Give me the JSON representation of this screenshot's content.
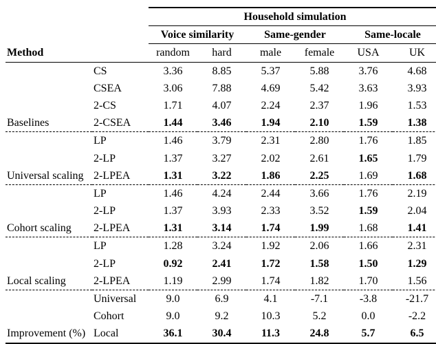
{
  "header": {
    "super": "Household simulation",
    "groups": {
      "g0": "Voice similarity",
      "g1": "Same-gender",
      "g2": "Same-locale"
    },
    "method": "Method",
    "cols": {
      "c0": "random",
      "c1": "hard",
      "c2": "male",
      "c3": "female",
      "c4": "USA",
      "c5": "UK"
    }
  },
  "sections": {
    "baselines": "Baselines",
    "universal": "Universal scaling",
    "cohort": "Cohort scaling",
    "local": "Local scaling",
    "improve": "Improvement (%)"
  },
  "methods": {
    "cs": "CS",
    "csea": "CSEA",
    "twocs": "2-CS",
    "twocsea": "2-CSEA",
    "lp": "LP",
    "twolp": "2-LP",
    "twolpea": "2-LPEA",
    "imp_u": "Universal",
    "imp_c": "Cohort",
    "imp_l": "Local"
  },
  "v": {
    "b_cs": {
      "c0": "3.36",
      "c1": "8.85",
      "c2": "5.37",
      "c3": "5.88",
      "c4": "3.76",
      "c5": "4.68"
    },
    "b_csea": {
      "c0": "3.06",
      "c1": "7.88",
      "c2": "4.69",
      "c3": "5.42",
      "c4": "3.63",
      "c5": "3.93"
    },
    "b_2cs": {
      "c0": "1.71",
      "c1": "4.07",
      "c2": "2.24",
      "c3": "2.37",
      "c4": "1.96",
      "c5": "1.53"
    },
    "b_2csea": {
      "c0": "1.44",
      "c1": "3.46",
      "c2": "1.94",
      "c3": "2.10",
      "c4": "1.59",
      "c5": "1.38"
    },
    "u_lp": {
      "c0": "1.46",
      "c1": "3.79",
      "c2": "2.31",
      "c3": "2.80",
      "c4": "1.76",
      "c5": "1.85"
    },
    "u_2lp": {
      "c0": "1.37",
      "c1": "3.27",
      "c2": "2.02",
      "c3": "2.61",
      "c4": "1.65",
      "c5": "1.79"
    },
    "u_2lpea": {
      "c0": "1.31",
      "c1": "3.22",
      "c2": "1.86",
      "c3": "2.25",
      "c4": "1.69",
      "c5": "1.68"
    },
    "c_lp": {
      "c0": "1.46",
      "c1": "4.24",
      "c2": "2.44",
      "c3": "3.66",
      "c4": "1.76",
      "c5": "2.19"
    },
    "c_2lp": {
      "c0": "1.37",
      "c1": "3.93",
      "c2": "2.33",
      "c3": "3.52",
      "c4": "1.59",
      "c5": "2.04"
    },
    "c_2lpea": {
      "c0": "1.31",
      "c1": "3.14",
      "c2": "1.74",
      "c3": "1.99",
      "c4": "1.68",
      "c5": "1.41"
    },
    "l_lp": {
      "c0": "1.28",
      "c1": "3.24",
      "c2": "1.92",
      "c3": "2.06",
      "c4": "1.66",
      "c5": "2.31"
    },
    "l_2lp": {
      "c0": "0.92",
      "c1": "2.41",
      "c2": "1.72",
      "c3": "1.58",
      "c4": "1.50",
      "c5": "1.29"
    },
    "l_2lpea": {
      "c0": "1.19",
      "c1": "2.99",
      "c2": "1.74",
      "c3": "1.82",
      "c4": "1.70",
      "c5": "1.56"
    },
    "i_u": {
      "c0": "9.0",
      "c1": "6.9",
      "c2": "4.1",
      "c3": "-7.1",
      "c4": "-3.8",
      "c5": "-21.7"
    },
    "i_c": {
      "c0": "9.0",
      "c1": "9.2",
      "c2": "10.3",
      "c3": "5.2",
      "c4": "0.0",
      "c5": "-2.2"
    },
    "i_l": {
      "c0": "36.1",
      "c1": "30.4",
      "c2": "11.3",
      "c3": "24.8",
      "c4": "5.7",
      "c5": "6.5"
    }
  },
  "chart_data": {
    "type": "table",
    "title": "Household simulation",
    "column_groups": [
      {
        "name": "Voice similarity",
        "columns": [
          "random",
          "hard"
        ]
      },
      {
        "name": "Same-gender",
        "columns": [
          "male",
          "female"
        ]
      },
      {
        "name": "Same-locale",
        "columns": [
          "USA",
          "UK"
        ]
      }
    ],
    "columns": [
      "random",
      "hard",
      "male",
      "female",
      "USA",
      "UK"
    ],
    "rows": [
      {
        "section": "Baselines",
        "method": "CS",
        "values": [
          3.36,
          8.85,
          5.37,
          5.88,
          3.76,
          4.68
        ],
        "bold": [
          false,
          false,
          false,
          false,
          false,
          false
        ]
      },
      {
        "section": "Baselines",
        "method": "CSEA",
        "values": [
          3.06,
          7.88,
          4.69,
          5.42,
          3.63,
          3.93
        ],
        "bold": [
          false,
          false,
          false,
          false,
          false,
          false
        ]
      },
      {
        "section": "Baselines",
        "method": "2-CS",
        "values": [
          1.71,
          4.07,
          2.24,
          2.37,
          1.96,
          1.53
        ],
        "bold": [
          false,
          false,
          false,
          false,
          false,
          false
        ]
      },
      {
        "section": "Baselines",
        "method": "2-CSEA",
        "values": [
          1.44,
          3.46,
          1.94,
          2.1,
          1.59,
          1.38
        ],
        "bold": [
          true,
          true,
          true,
          true,
          true,
          true
        ]
      },
      {
        "section": "Universal scaling",
        "method": "LP",
        "values": [
          1.46,
          3.79,
          2.31,
          2.8,
          1.76,
          1.85
        ],
        "bold": [
          false,
          false,
          false,
          false,
          false,
          false
        ]
      },
      {
        "section": "Universal scaling",
        "method": "2-LP",
        "values": [
          1.37,
          3.27,
          2.02,
          2.61,
          1.65,
          1.79
        ],
        "bold": [
          false,
          false,
          false,
          false,
          true,
          false
        ]
      },
      {
        "section": "Universal scaling",
        "method": "2-LPEA",
        "values": [
          1.31,
          3.22,
          1.86,
          2.25,
          1.69,
          1.68
        ],
        "bold": [
          true,
          true,
          true,
          true,
          false,
          true
        ]
      },
      {
        "section": "Cohort scaling",
        "method": "LP",
        "values": [
          1.46,
          4.24,
          2.44,
          3.66,
          1.76,
          2.19
        ],
        "bold": [
          false,
          false,
          false,
          false,
          false,
          false
        ]
      },
      {
        "section": "Cohort scaling",
        "method": "2-LP",
        "values": [
          1.37,
          3.93,
          2.33,
          3.52,
          1.59,
          2.04
        ],
        "bold": [
          false,
          false,
          false,
          false,
          true,
          false
        ]
      },
      {
        "section": "Cohort scaling",
        "method": "2-LPEA",
        "values": [
          1.31,
          3.14,
          1.74,
          1.99,
          1.68,
          1.41
        ],
        "bold": [
          true,
          true,
          true,
          true,
          false,
          true
        ]
      },
      {
        "section": "Local scaling",
        "method": "LP",
        "values": [
          1.28,
          3.24,
          1.92,
          2.06,
          1.66,
          2.31
        ],
        "bold": [
          false,
          false,
          false,
          false,
          false,
          false
        ]
      },
      {
        "section": "Local scaling",
        "method": "2-LP",
        "values": [
          0.92,
          2.41,
          1.72,
          1.58,
          1.5,
          1.29
        ],
        "bold": [
          true,
          true,
          true,
          true,
          true,
          true
        ]
      },
      {
        "section": "Local scaling",
        "method": "2-LPEA",
        "values": [
          1.19,
          2.99,
          1.74,
          1.82,
          1.7,
          1.56
        ],
        "bold": [
          false,
          false,
          false,
          false,
          false,
          false
        ]
      },
      {
        "section": "Improvement (%)",
        "method": "Universal",
        "values": [
          9.0,
          6.9,
          4.1,
          -7.1,
          -3.8,
          -21.7
        ],
        "bold": [
          false,
          false,
          false,
          false,
          false,
          false
        ]
      },
      {
        "section": "Improvement (%)",
        "method": "Cohort",
        "values": [
          9.0,
          9.2,
          10.3,
          5.2,
          0.0,
          -2.2
        ],
        "bold": [
          false,
          false,
          false,
          false,
          false,
          false
        ]
      },
      {
        "section": "Improvement (%)",
        "method": "Local",
        "values": [
          36.1,
          30.4,
          11.3,
          24.8,
          5.7,
          6.5
        ],
        "bold": [
          true,
          true,
          true,
          true,
          true,
          true
        ]
      }
    ]
  }
}
